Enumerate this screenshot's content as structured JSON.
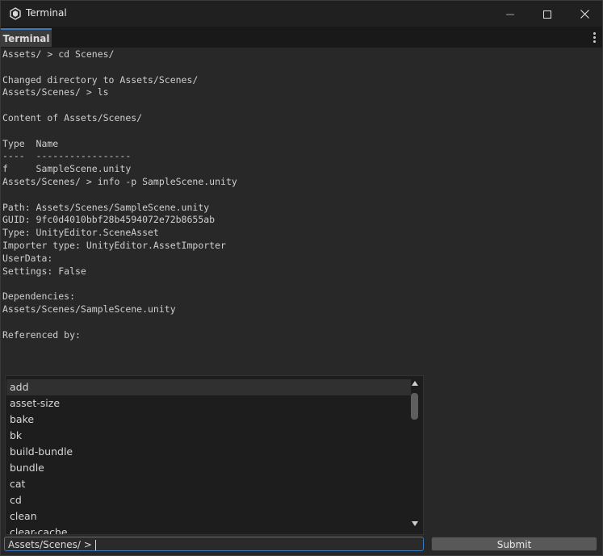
{
  "window": {
    "title": "Terminal",
    "minimize_icon": "minimize-icon",
    "maximize_icon": "maximize-icon",
    "close_icon": "close-icon"
  },
  "tabs": [
    {
      "label": "Terminal",
      "active": true
    }
  ],
  "output_lines": [
    "Assets/ > cd Scenes/",
    "",
    "Changed directory to Assets/Scenes/",
    "Assets/Scenes/ > ls",
    "",
    "Content of Assets/Scenes/",
    "",
    "Type  Name",
    "----  -----------------",
    "f     SampleScene.unity",
    "Assets/Scenes/ > info -p SampleScene.unity",
    "",
    "Path: Assets/Scenes/SampleScene.unity",
    "GUID: 9fc0d4010bbf28b4594072e72b8655ab",
    "Type: UnityEditor.SceneAsset",
    "Importer type: UnityEditor.AssetImporter",
    "UserData:",
    "Settings: False",
    "",
    "Dependencies:",
    "Assets/Scenes/SampleScene.unity",
    "",
    "Referenced by:"
  ],
  "suggestions": [
    {
      "label": "add",
      "selected": true
    },
    {
      "label": "asset-size"
    },
    {
      "label": "bake"
    },
    {
      "label": "bk"
    },
    {
      "label": "build-bundle"
    },
    {
      "label": "bundle"
    },
    {
      "label": "cat"
    },
    {
      "label": "cd"
    },
    {
      "label": "clean"
    },
    {
      "label": "clear-cache"
    }
  ],
  "prompt": "Assets/Scenes/ >",
  "submit_label": "Submit",
  "colors": {
    "accent": "#3a79bb",
    "background": "#282828",
    "text": "#cfcfcf"
  }
}
